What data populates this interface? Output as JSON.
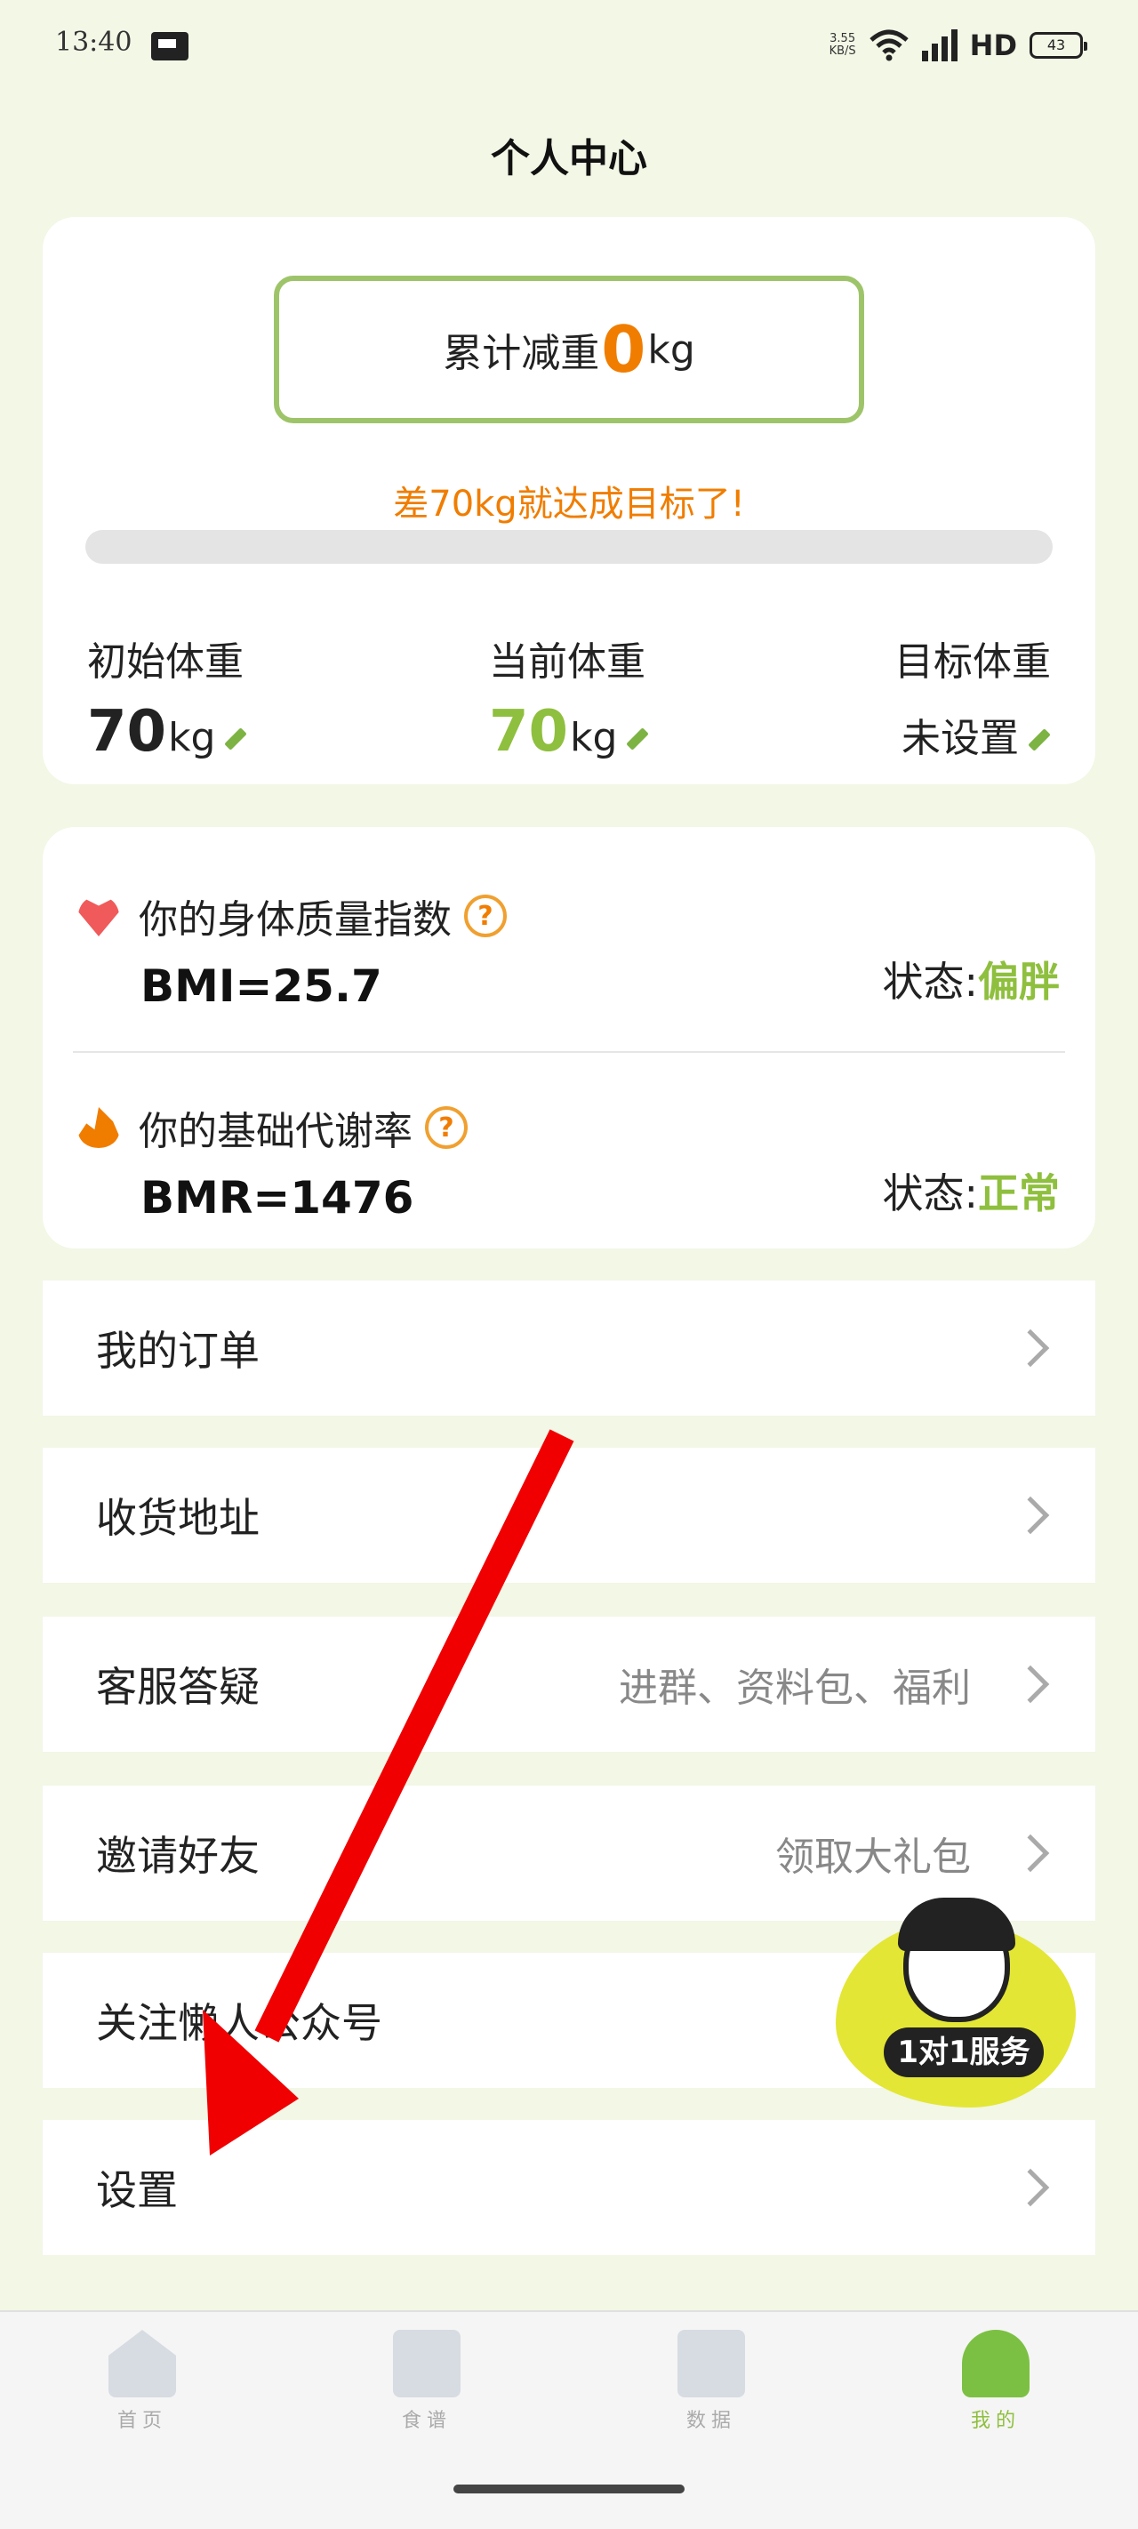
{
  "status_bar": {
    "time": "13:40",
    "net_speed_value": "3.55",
    "net_speed_unit": "KB/S",
    "network": "4G",
    "hd": "HD",
    "battery": "43"
  },
  "page_title": "个人中心",
  "weight_summary": {
    "total_prefix": "累计减重",
    "total_value": "0",
    "total_unit": "kg",
    "goal_message": "差70kg就达成目标了!",
    "progress_percent": 0,
    "initial": {
      "label": "初始体重",
      "value": "70",
      "unit": "kg"
    },
    "current": {
      "label": "当前体重",
      "value": "70",
      "unit": "kg"
    },
    "target": {
      "label": "目标体重",
      "value": "未设置"
    }
  },
  "indices": {
    "bmi": {
      "title": "你的身体质量指数",
      "value": "BMI=25.7",
      "state_label": "状态:",
      "state_value": "偏胖"
    },
    "bmr": {
      "title": "你的基础代谢率",
      "value": "BMR=1476",
      "state_label": "状态:",
      "state_value": "正常"
    }
  },
  "menu": {
    "orders": {
      "label": "我的订单"
    },
    "address": {
      "label": "收货地址"
    },
    "service": {
      "label": "客服答疑",
      "sub": "进群、资料包、福利"
    },
    "invite": {
      "label": "邀请好友",
      "sub": "领取大礼包"
    },
    "follow": {
      "label": "关注懒人公众号"
    },
    "settings": {
      "label": "设置"
    }
  },
  "service_badge": {
    "label": "1对1服务"
  },
  "tabbar": [
    {
      "label": "首页"
    },
    {
      "label": "食谱"
    },
    {
      "label": "数据"
    },
    {
      "label": "我的"
    }
  ],
  "colors": {
    "accent_green": "#8fbf3e",
    "accent_orange": "#f07d00",
    "arrow_red": "#f00000"
  }
}
